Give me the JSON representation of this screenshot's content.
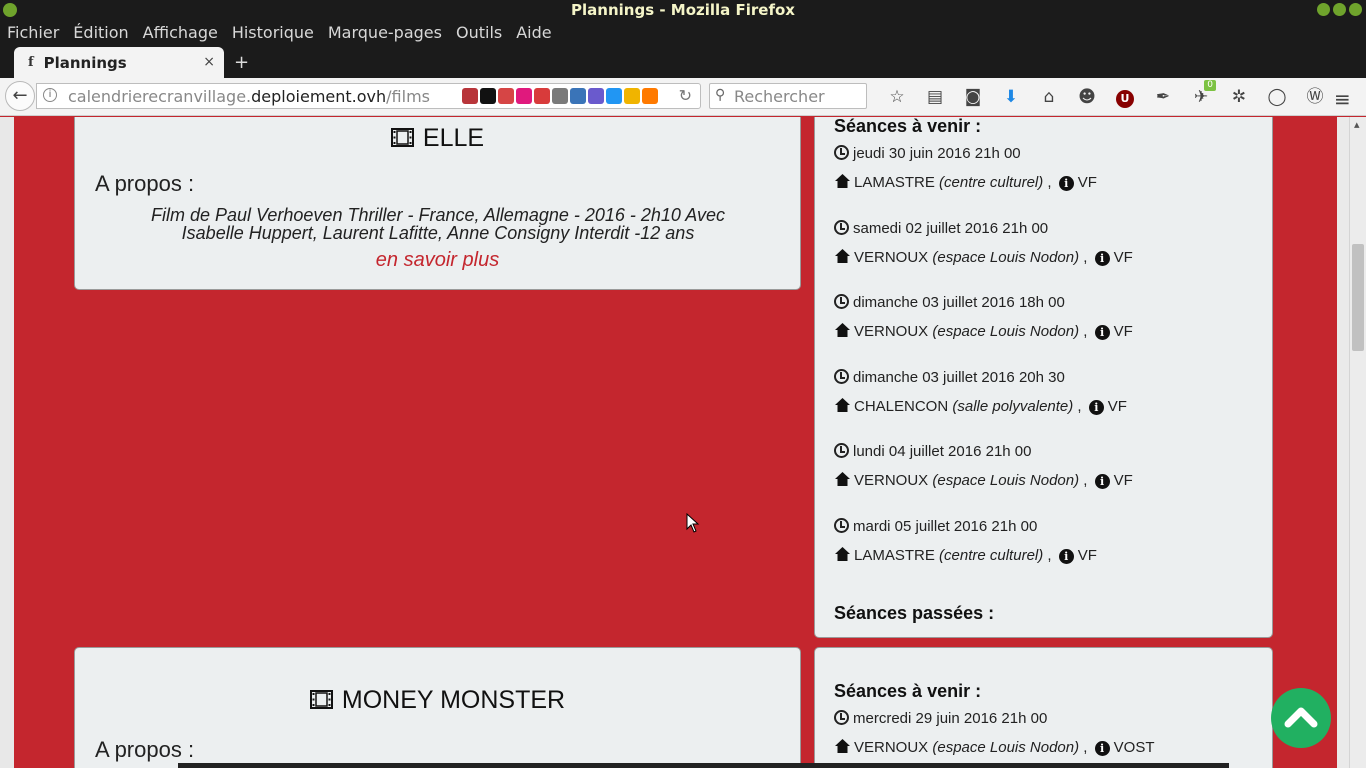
{
  "window": {
    "title": "Plannings - Mozilla Firefox"
  },
  "menu": [
    "Fichier",
    "Édition",
    "Affichage",
    "Historique",
    "Marque-pages",
    "Outils",
    "Aide"
  ],
  "tab": {
    "title": "Plannings",
    "icon": "f",
    "close": "×",
    "new": "+"
  },
  "nav": {
    "back": "←",
    "url_prefix": "calendrierecranvillage.",
    "url_domain": "deploiement.ovh",
    "url_path": "/films",
    "reload": "↻",
    "search_placeholder": "Rechercher",
    "addon_colors": [
      "#b8353a",
      "#111111",
      "#d64545",
      "#e0197d",
      "#d83b3b",
      "#7a7a7a",
      "#3a74b8",
      "#6a5acd",
      "#2196f3",
      "#f0b400",
      "#ff7a00"
    ],
    "badge": "0",
    "ublock": "U"
  },
  "films": [
    {
      "title": "ELLE",
      "apropos": "A propos :",
      "synopsis_line1": "Film de Paul Verhoeven Thriller - France, Allemagne - 2016 - 2h10 Avec",
      "synopsis_line2": "Isabelle Huppert, Laurent Lafitte, Anne Consigny Interdit -12 ans",
      "more": "en savoir plus",
      "upcoming_head": "Séances à venir :",
      "past_head": "Séances passées :",
      "sessions": [
        {
          "date": "jeudi 30 juin 2016 21h 00",
          "town": "LAMASTRE",
          "venue": "(centre culturel)",
          "lang": "VF"
        },
        {
          "date": "samedi 02 juillet 2016 21h 00",
          "town": "VERNOUX",
          "venue": "(espace Louis Nodon)",
          "lang": "VF"
        },
        {
          "date": "dimanche 03 juillet 2016 18h 00",
          "town": "VERNOUX",
          "venue": "(espace Louis Nodon)",
          "lang": "VF"
        },
        {
          "date": "dimanche 03 juillet 2016 20h 30",
          "town": "CHALENCON",
          "venue": "(salle polyvalente)",
          "lang": "VF"
        },
        {
          "date": "lundi 04 juillet 2016 21h 00",
          "town": "VERNOUX",
          "venue": "(espace Louis Nodon)",
          "lang": "VF"
        },
        {
          "date": "mardi 05 juillet 2016 21h 00",
          "town": "LAMASTRE",
          "venue": "(centre culturel)",
          "lang": "VF"
        }
      ]
    },
    {
      "title": "MONEY MONSTER",
      "apropos": "A propos :",
      "upcoming_head": "Séances à venir :",
      "sessions": [
        {
          "date": "mercredi 29 juin 2016 21h 00",
          "town": "VERNOUX",
          "venue": "(espace Louis Nodon)",
          "lang": "VOST"
        }
      ]
    }
  ],
  "colors": {
    "page_background": "#c4262e",
    "panel": "#eceff0",
    "link": "#c4262e",
    "back_to_top": "#21b061"
  }
}
